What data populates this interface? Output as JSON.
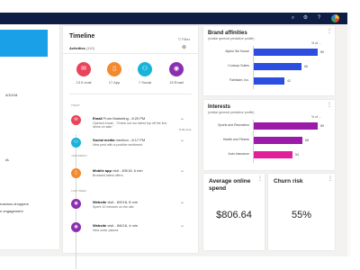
{
  "colors": {
    "nav": "#0f1d45",
    "accent": "#1aa0e6",
    "brand_bar": "#2b4de0",
    "interest_bar": "#9b1aa8",
    "interest_bar_light": "#e31e9b"
  },
  "topbar": {
    "icons": [
      "search-icon",
      "gear-icon",
      "help-icon",
      "avatar"
    ]
  },
  "left_panel": {
    "text1": "4/10/18",
    "text2": "IA",
    "text3": "rracious shoppers",
    "text4": "n engagement"
  },
  "timeline": {
    "title": "Timeline",
    "filter": "Filter",
    "activities_label": "Activities",
    "activities_count": "(119)",
    "counters": [
      {
        "label": "13 E-mail",
        "icon": "mail-icon",
        "color": "#e8445a",
        "glyph": "✉"
      },
      {
        "label": "17 App",
        "icon": "phone-icon",
        "color": "#f28a2e",
        "glyph": "▯"
      },
      {
        "label": "7 Social",
        "icon": "people-icon",
        "color": "#18b4d8",
        "glyph": "⚇"
      },
      {
        "label": "15 Email",
        "icon": "web-icon",
        "color": "#8b2fb0",
        "glyph": "◉"
      }
    ],
    "sections": {
      "today": "TODAY",
      "yesterday": "YESTERDAY",
      "last_week": "LAST WEEK"
    },
    "sort": "By time",
    "events": [
      {
        "title": "Email",
        "title_rest": "From Marketing - 8:20 PM",
        "sub": "Opened email - \"Check out our latest top off the line items on sale.\"",
        "icon": "mail-icon",
        "color": "#e8445a",
        "glyph": "✉"
      },
      {
        "title": "Social media",
        "title_rest": "mention - 8:17 PM",
        "sub": "New post with a positive sentiment",
        "icon": "people-icon",
        "color": "#18b4d8",
        "glyph": "⚇"
      },
      {
        "title": "Mobile app",
        "title_rest": "visit - 8/5/18, 6 min",
        "sub": "Browsed latest offers.",
        "icon": "phone-icon",
        "color": "#f28a2e",
        "glyph": "▯"
      },
      {
        "title": "Website",
        "title_rest": "visit - 8/9/18, 8 min",
        "sub": "Spent 10 minutes on the site.",
        "icon": "web-icon",
        "color": "#8b2fb0",
        "glyph": "◉"
      },
      {
        "title": "Website",
        "title_rest": "visit - 8/6/18, 4 min",
        "sub": "New order placed.",
        "icon": "web-icon",
        "color": "#8b2fb0",
        "glyph": "◉"
      }
    ]
  },
  "brand": {
    "title": "Brand affinities",
    "sub": "(similar general predictive profile)",
    "pct": "% of ...",
    "rows": [
      {
        "label": "Alpine Ski House",
        "value": 89
      },
      {
        "label": "Contoso Suites",
        "value": 66
      },
      {
        "label": "Fabrikam, Inc.",
        "value": 42
      }
    ]
  },
  "interests": {
    "title": "Interests",
    "sub": "(similar general predictive profile)",
    "pct": "% of ...",
    "rows": [
      {
        "label": "Sports and Recreation",
        "value": 89
      },
      {
        "label": "Health and Fitness",
        "value": 68
      },
      {
        "label": "Auto Insurance",
        "value": 54
      }
    ]
  },
  "kpis": {
    "avg_title": "Average online spend",
    "avg_value": "$806.64",
    "churn_title": "Churn risk",
    "churn_value": "55%"
  }
}
